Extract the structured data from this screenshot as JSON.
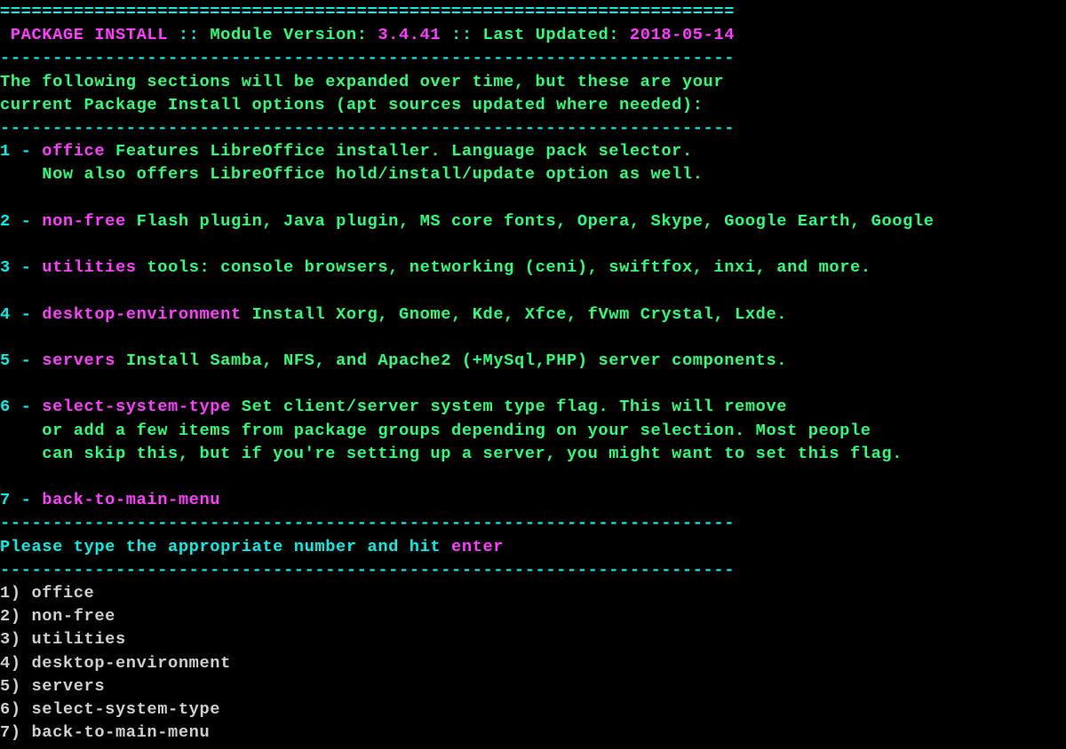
{
  "header": {
    "border": "======================================================================",
    "title": "PACKAGE INSTALL",
    "sep1": " :: ",
    "version_label": "Module Version: ",
    "version_value": "3.4.41",
    "sep2": " :: ",
    "updated_label": "Last Updated: ",
    "updated_value": "2018-05-14",
    "dashline": "----------------------------------------------------------------------"
  },
  "intro": {
    "line1": "The following sections will be expanded over time, but these are your",
    "line2": "current Package Install options (apt sources updated where needed):"
  },
  "items": [
    {
      "num": "1",
      "dash": " - ",
      "name": "office",
      "space": " ",
      "desc": "Features LibreOffice installer. Language pack selector.",
      "cont": [
        "    Now also offers LibreOffice hold/install/update option as well."
      ]
    },
    {
      "num": "2",
      "dash": " - ",
      "name": "non-free",
      "space": " ",
      "desc": "Flash plugin, Java plugin, MS core fonts, Opera, Skype, Google Earth, Google",
      "cont": []
    },
    {
      "num": "3",
      "dash": " - ",
      "name": "utilities",
      "space": " ",
      "desc": "tools: console browsers, networking (ceni), swiftfox, inxi, and more.",
      "cont": []
    },
    {
      "num": "4",
      "dash": " - ",
      "name": "desktop-environment",
      "space": " ",
      "desc": "Install Xorg, Gnome, Kde, Xfce, fVwm Crystal, Lxde.",
      "cont": []
    },
    {
      "num": "5",
      "dash": " - ",
      "name": "servers",
      "space": " ",
      "desc": "Install Samba, NFS, and Apache2 (+MySql,PHP) server components.",
      "cont": []
    },
    {
      "num": "6",
      "dash": " - ",
      "name": "select-system-type",
      "space": " ",
      "desc": "Set client/server system type flag. This will remove",
      "cont": [
        "    or add a few items from package groups depending on your selection. Most people",
        "    can skip this, but if you're setting up a server, you might want to set this flag."
      ]
    },
    {
      "num": "7",
      "dash": " - ",
      "name": "back-to-main-menu",
      "space": "",
      "desc": "",
      "cont": []
    }
  ],
  "prompt": {
    "pre": "Please type the appropriate number and hit ",
    "key": "enter"
  },
  "list": {
    "entries": [
      "1) office",
      "2) non-free",
      "3) utilities",
      "4) desktop-environment",
      "5) servers",
      "6) select-system-type",
      "7) back-to-main-menu"
    ]
  }
}
